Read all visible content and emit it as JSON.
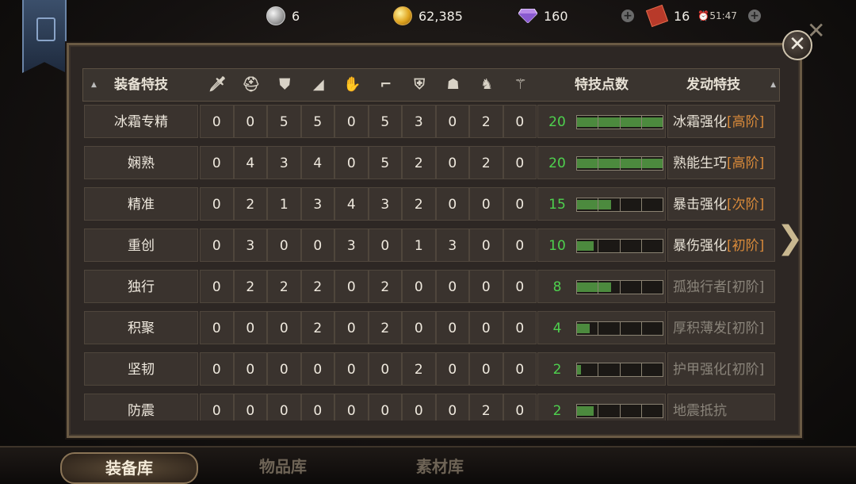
{
  "resources": {
    "silver": "6",
    "gold": "62,385",
    "diamond": "160",
    "tickets": "16",
    "timer": "51:47"
  },
  "headers": {
    "trait": "装备特技",
    "points": "特技点数",
    "activate": "发动特技"
  },
  "slot_icons": [
    "sword-icon",
    "helmet-icon",
    "chest-armor-icon",
    "shoulder-icon",
    "glove-icon",
    "boots-icon",
    "shield-icon",
    "mask-icon",
    "horse-icon",
    "accessory-icon"
  ],
  "rows": [
    {
      "name": "冰霜专精",
      "values": [
        "0",
        "0",
        "5",
        "5",
        "0",
        "5",
        "3",
        "0",
        "2",
        "0"
      ],
      "points": "20",
      "fill": 1.0,
      "trait": "冰霜强化",
      "level": "[高阶]",
      "active": true
    },
    {
      "name": "娴熟",
      "values": [
        "0",
        "4",
        "3",
        "4",
        "0",
        "5",
        "2",
        "0",
        "2",
        "0"
      ],
      "points": "20",
      "fill": 1.0,
      "trait": "熟能生巧",
      "level": "[高阶]",
      "active": true
    },
    {
      "name": "精准",
      "values": [
        "0",
        "2",
        "1",
        "3",
        "4",
        "3",
        "2",
        "0",
        "0",
        "0"
      ],
      "points": "15",
      "fill": 0.4,
      "trait": "暴击强化",
      "level": "[次阶]",
      "active": true
    },
    {
      "name": "重创",
      "values": [
        "0",
        "3",
        "0",
        "0",
        "3",
        "0",
        "1",
        "3",
        "0",
        "0"
      ],
      "points": "10",
      "fill": 0.2,
      "trait": "暴伤强化",
      "level": "[初阶]",
      "active": true
    },
    {
      "name": "独行",
      "values": [
        "0",
        "2",
        "2",
        "2",
        "0",
        "2",
        "0",
        "0",
        "0",
        "0"
      ],
      "points": "8",
      "fill": 0.4,
      "trait": "孤独行者",
      "level": "[初阶]",
      "active": false
    },
    {
      "name": "积聚",
      "values": [
        "0",
        "0",
        "0",
        "2",
        "0",
        "2",
        "0",
        "0",
        "0",
        "0"
      ],
      "points": "4",
      "fill": 0.15,
      "trait": "厚积薄发",
      "level": "[初阶]",
      "active": false
    },
    {
      "name": "坚韧",
      "values": [
        "0",
        "0",
        "0",
        "0",
        "0",
        "0",
        "2",
        "0",
        "0",
        "0"
      ],
      "points": "2",
      "fill": 0.05,
      "trait": "护甲强化",
      "level": "[初阶]",
      "active": false
    },
    {
      "name": "防震",
      "values": [
        "0",
        "0",
        "0",
        "0",
        "0",
        "0",
        "0",
        "0",
        "2",
        "0"
      ],
      "points": "2",
      "fill": 0.2,
      "trait": "地震抵抗",
      "level": "",
      "active": false
    }
  ],
  "tabs": [
    "装备库",
    "物品库",
    "素材库"
  ],
  "active_tab": 0,
  "colors": {
    "points_green": "#4ed14e",
    "level_orange": "#d98a3a",
    "bar_fill": "#4c8a3e"
  }
}
